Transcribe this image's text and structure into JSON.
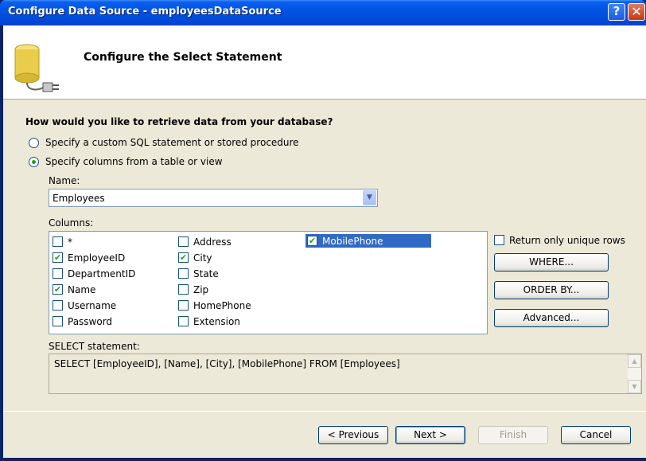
{
  "window": {
    "title": "Configure Data Source - employeesDataSource",
    "help_glyph": "?",
    "close_glyph": "✕"
  },
  "header": {
    "title": "Configure the Select Statement",
    "icon": "database-plug-icon"
  },
  "question": "How would you like to retrieve data from your database?",
  "options": [
    {
      "label": "Specify a custom SQL statement or stored procedure",
      "selected": false
    },
    {
      "label": "Specify columns from a table or view",
      "selected": true
    }
  ],
  "name_field": {
    "label": "Name:",
    "value": "Employees"
  },
  "columns": {
    "label": "Columns:",
    "items": [
      {
        "name": "*",
        "checked": false
      },
      {
        "name": "EmployeeID",
        "checked": true
      },
      {
        "name": "DepartmentID",
        "checked": false
      },
      {
        "name": "Name",
        "checked": true
      },
      {
        "name": "Username",
        "checked": false
      },
      {
        "name": "Password",
        "checked": false
      },
      {
        "name": "Address",
        "checked": false
      },
      {
        "name": "City",
        "checked": true
      },
      {
        "name": "State",
        "checked": false
      },
      {
        "name": "Zip",
        "checked": false
      },
      {
        "name": "HomePhone",
        "checked": false
      },
      {
        "name": "Extension",
        "checked": false
      },
      {
        "name": "MobilePhone",
        "checked": true,
        "highlighted": true
      }
    ]
  },
  "unique_rows": {
    "label": "Return only unique rows",
    "checked": false
  },
  "side_buttons": {
    "where": "WHERE...",
    "order_by": "ORDER BY...",
    "advanced": "Advanced..."
  },
  "select_statement": {
    "label": "SELECT statement:",
    "value": "SELECT [EmployeeID], [Name], [City], [MobilePhone] FROM [Employees]"
  },
  "footer": {
    "previous": "< Previous",
    "next": "Next >",
    "finish": "Finish",
    "cancel": "Cancel",
    "finish_disabled": true
  },
  "colors": {
    "titlebar": "#0054e3",
    "dialog_bg": "#ece9d8",
    "selection": "#316ac5",
    "check": "#21a121"
  }
}
